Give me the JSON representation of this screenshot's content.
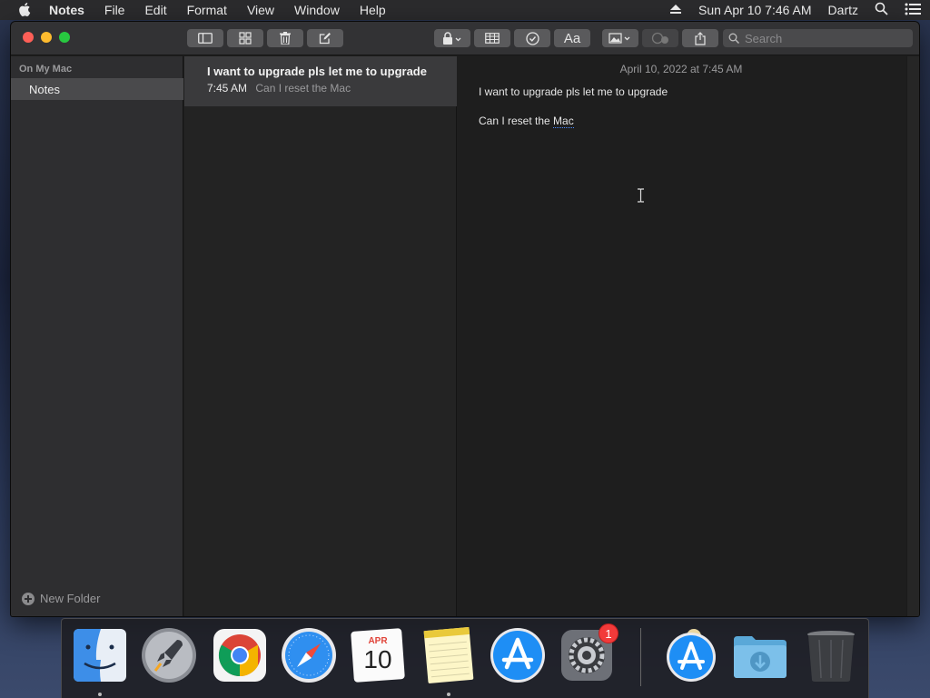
{
  "menubar": {
    "app_name": "Notes",
    "menus": [
      "File",
      "Edit",
      "Format",
      "View",
      "Window",
      "Help"
    ],
    "clock": "Sun Apr 10  7:46 AM",
    "user": "Dartz"
  },
  "toolbar": {
    "search_placeholder": "Search"
  },
  "sidebar": {
    "section_header": "On My Mac",
    "folders": [
      {
        "label": "Notes",
        "selected": true
      }
    ],
    "new_folder_label": "New Folder"
  },
  "notelist": {
    "notes": [
      {
        "title": "I want to upgrade pls let me to upgrade",
        "time": "7:45 AM",
        "preview": "Can I reset the Mac",
        "selected": true
      }
    ]
  },
  "editor": {
    "date": "April 10, 2022 at 7:45 AM",
    "line1": "I want to upgrade pls let me to upgrade",
    "line2_prefix": "Can I reset the ",
    "line2_misspelled": "Mac"
  },
  "dock": {
    "items": [
      "Finder",
      "Launchpad",
      "Google Chrome",
      "Safari",
      "Calendar",
      "Notes",
      "App Store",
      "System Preferences",
      "App Store Installer",
      "Downloads",
      "Trash"
    ],
    "calendar_month": "APR",
    "calendar_day": "10",
    "sysprefs_badge": "1"
  },
  "colors": {
    "menubar_bg": "#2b2b2d",
    "titlebar_bg": "#323234",
    "sidebar_bg": "#2e2e30",
    "selected_row": "#3a3a3c",
    "editor_bg": "#1e1e1e",
    "close": "#fe5f57",
    "minimize": "#febb2e",
    "maximize": "#28c840"
  }
}
